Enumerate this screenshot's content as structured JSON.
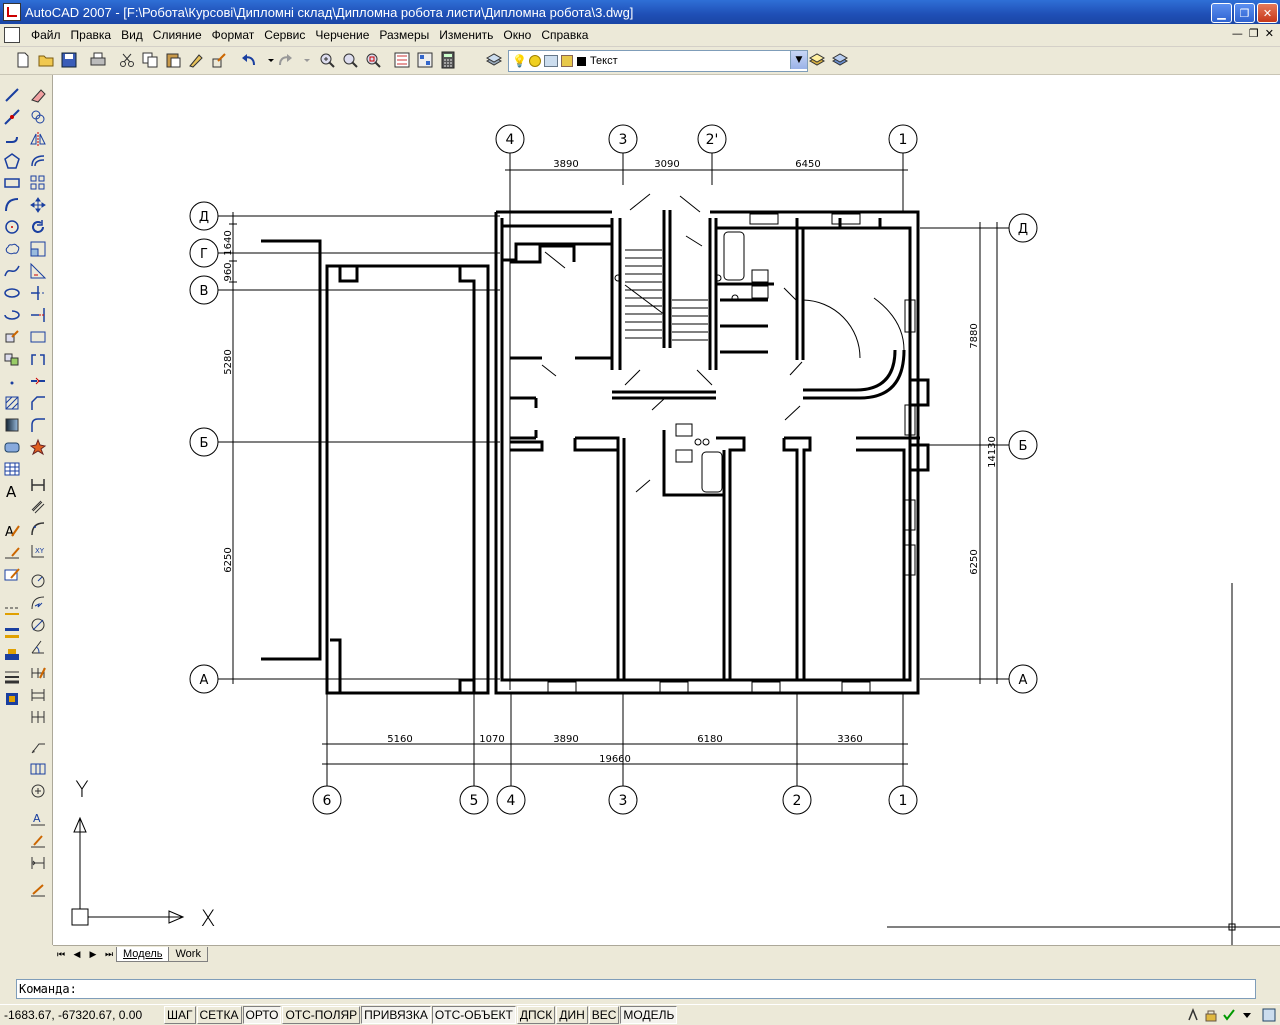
{
  "window": {
    "title": "AutoCAD 2007 - [F:\\Робота\\Курсові\\Дипломні склад\\Дипломна робота листи\\Дипломна робота\\3.dwg]",
    "buttons": [
      "minimize",
      "restore",
      "close"
    ]
  },
  "menu": {
    "items": [
      "Файл",
      "Правка",
      "Вид",
      "Слияние",
      "Формат",
      "Сервис",
      "Черчение",
      "Размеры",
      "Изменить",
      "Окно",
      "Справка"
    ]
  },
  "toolbar": {
    "layer_name": "Текст",
    "icons": [
      "new-icon",
      "open-icon",
      "save-icon",
      "plot-icon",
      "cut-icon",
      "copy-icon",
      "paste-icon",
      "match-properties-icon",
      "block-editor-icon",
      "undo-icon",
      "redo-icon",
      "pan-icon",
      "zoom-realtime-icon",
      "zoom-window-icon",
      "zoom-previous-icon",
      "properties-icon",
      "design-center-icon",
      "tool-palettes-icon",
      "calculator-icon",
      "layer-manager-icon",
      "layer-previous-icon",
      "layer-states-icon"
    ]
  },
  "drawing": {
    "axes_top": [
      "4",
      "3",
      "2'",
      "1"
    ],
    "axes_bottom": [
      "6",
      "5",
      "4",
      "3",
      "2",
      "1"
    ],
    "axes_left": [
      "Д",
      "Г",
      "В",
      "Б",
      "А"
    ],
    "axes_right": [
      "Д",
      "Б",
      "А"
    ],
    "dims_top": [
      "3890",
      "3090",
      "6450"
    ],
    "dims_bottom_row1": [
      "5160",
      "1070",
      "3890",
      "6180",
      "3360"
    ],
    "dims_bottom_total": "19660",
    "dims_left": [
      "1640",
      "960",
      "5280",
      "6250"
    ],
    "dims_right": [
      "7880",
      "6250"
    ],
    "dims_right_total": "14130",
    "ucs_x": "X",
    "ucs_y": "Y"
  },
  "tabs": {
    "items": [
      "Модель",
      "Work"
    ],
    "active": "Модель"
  },
  "command": {
    "prompt": "Команда:"
  },
  "status": {
    "coordinates": "-1683.67, -67320.67, 0.00",
    "toggles": [
      "ШАГ",
      "СЕТКА",
      "ОРТО",
      "ОТС-ПОЛЯР",
      "ПРИВЯЗКА",
      "ОТС-ОБЪЕКТ",
      "ДПСК",
      "ДИН",
      "ВЕС",
      "МОДЕЛЬ"
    ],
    "active_toggles": [
      "ОРТО",
      "ПРИВЯЗКА",
      "ОТС-ОБЪЕКТ",
      "МОДЕЛЬ"
    ]
  }
}
